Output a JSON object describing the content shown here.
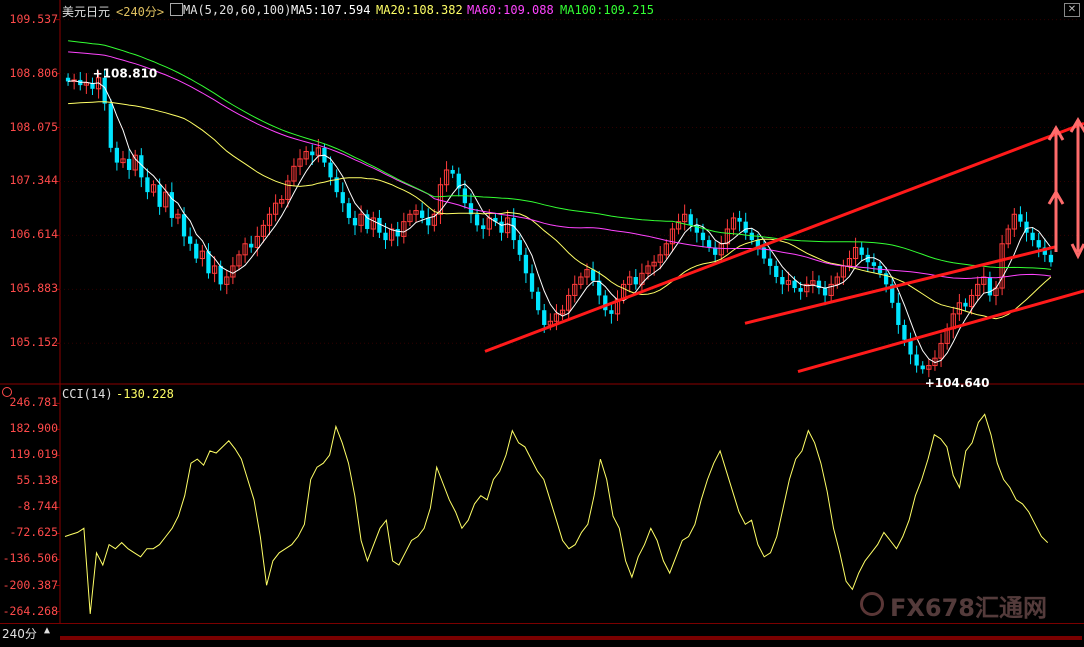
{
  "header": {
    "symbol": "美元日元",
    "period_label": "<240分>",
    "ma_icon": "chart-indicator-icon",
    "ma_params": "MA(5,20,60,100)",
    "ma5": "MA5:107.594",
    "ma20": "MA20:108.382",
    "ma60": "MA60:109.088",
    "ma100": "MA100:109.215"
  },
  "cci_header": {
    "label": "CCI(14)",
    "value": "-130.228"
  },
  "footer": {
    "period_tab": "240分",
    "period_arrow": "▲"
  },
  "watermark": {
    "text": "FX678汇通网"
  },
  "colors": {
    "background": "#000000",
    "axis_label": "#ff4a4a",
    "candle_up": "#ff3b3b",
    "candle_down": "#00e5ff",
    "ma5": "#ffffff",
    "ma20": "#ffff66",
    "ma60": "#ff44ff",
    "ma100": "#33ff33",
    "cci": "#ffff66",
    "annotation": "#ff1a1a",
    "arrow": "#ff6b6b",
    "grid": "#8b0000"
  },
  "chart_data": [
    {
      "type": "candlestick",
      "title": "美元日元 240分",
      "ylim": [
        104.6,
        109.6
      ],
      "yticks": [
        109.537,
        108.806,
        108.075,
        107.344,
        106.614,
        105.883,
        105.152
      ],
      "annotations": [
        {
          "text": "108.810",
          "value": 108.81
        },
        {
          "text": "104.640",
          "value": 104.64
        }
      ],
      "series": [
        {
          "name": "Close",
          "values": [
            108.7,
            108.72,
            108.65,
            108.68,
            108.6,
            108.75,
            108.4,
            107.8,
            107.6,
            107.65,
            107.5,
            107.7,
            107.4,
            107.2,
            107.3,
            107.0,
            107.2,
            106.85,
            106.9,
            106.6,
            106.5,
            106.3,
            106.4,
            106.1,
            106.2,
            105.95,
            106.05,
            106.2,
            106.35,
            106.5,
            106.45,
            106.6,
            106.75,
            106.9,
            107.05,
            107.1,
            107.35,
            107.55,
            107.65,
            107.75,
            107.7,
            107.8,
            107.6,
            107.4,
            107.2,
            107.05,
            106.85,
            106.75,
            106.9,
            106.7,
            106.85,
            106.65,
            106.55,
            106.7,
            106.6,
            106.8,
            106.9,
            106.95,
            106.85,
            106.75,
            106.9,
            107.3,
            107.5,
            107.45,
            107.25,
            107.05,
            106.9,
            106.75,
            106.7,
            106.85,
            106.8,
            106.65,
            106.85,
            106.55,
            106.35,
            106.1,
            105.85,
            105.6,
            105.4,
            105.45,
            105.55,
            105.6,
            105.8,
            105.95,
            106.05,
            106.15,
            106.0,
            105.8,
            105.6,
            105.55,
            105.75,
            105.95,
            106.05,
            105.95,
            106.1,
            106.2,
            106.25,
            106.35,
            106.5,
            106.7,
            106.8,
            106.9,
            106.75,
            106.65,
            106.55,
            106.45,
            106.35,
            106.5,
            106.7,
            106.85,
            106.8,
            106.65,
            106.55,
            106.45,
            106.3,
            106.2,
            106.05,
            105.95,
            106.0,
            105.9,
            105.85,
            105.95,
            106.0,
            105.9,
            105.8,
            105.95,
            106.05,
            106.2,
            106.3,
            106.45,
            106.35,
            106.25,
            106.2,
            106.1,
            105.95,
            105.7,
            105.4,
            105.2,
            105.0,
            104.85,
            104.8,
            104.85,
            104.95,
            105.15,
            105.35,
            105.55,
            105.7,
            105.65,
            105.8,
            105.95,
            106.05,
            105.8,
            105.9,
            106.5,
            106.7,
            106.9,
            106.8,
            106.65,
            106.55,
            106.45,
            106.35,
            106.25
          ],
          "ma": {
            "MA5": 107.594,
            "MA20": 108.382,
            "MA60": 109.088,
            "MA100": 109.215
          }
        }
      ]
    },
    {
      "type": "line",
      "title": "CCI(14)",
      "ylim": [
        -290,
        260
      ],
      "yticks": [
        246.781,
        182.9,
        119.019,
        55.138,
        -8.744,
        -72.625,
        -136.506,
        -200.387,
        -264.268
      ],
      "series": [
        {
          "name": "CCI(14)",
          "values": [
            -80,
            -75,
            -70,
            -60,
            -270,
            -120,
            -150,
            -100,
            -110,
            -95,
            -110,
            -120,
            -130,
            -110,
            -110,
            -100,
            -80,
            -60,
            -30,
            20,
            100,
            110,
            95,
            130,
            125,
            140,
            155,
            135,
            110,
            60,
            10,
            -80,
            -200,
            -140,
            -120,
            -110,
            -100,
            -80,
            -50,
            60,
            90,
            100,
            120,
            190,
            150,
            100,
            20,
            -90,
            -140,
            -100,
            -60,
            -40,
            -140,
            -150,
            -120,
            -90,
            -80,
            -60,
            -10,
            90,
            50,
            10,
            -20,
            -60,
            -40,
            0,
            20,
            10,
            60,
            80,
            120,
            180,
            150,
            140,
            110,
            80,
            60,
            10,
            -40,
            -90,
            -110,
            -100,
            -70,
            -50,
            20,
            110,
            60,
            -30,
            -60,
            -140,
            -180,
            -130,
            -100,
            -60,
            -90,
            -140,
            -170,
            -130,
            -90,
            -80,
            -50,
            10,
            60,
            100,
            130,
            80,
            30,
            -20,
            -50,
            -40,
            -100,
            -130,
            -120,
            -80,
            -10,
            60,
            110,
            130,
            180,
            150,
            100,
            30,
            -60,
            -120,
            -190,
            -210,
            -170,
            -140,
            -120,
            -100,
            -70,
            -90,
            -110,
            -80,
            -40,
            20,
            60,
            110,
            170,
            160,
            140,
            70,
            40,
            130,
            150,
            200,
            220,
            170,
            100,
            60,
            40,
            10,
            0,
            -20,
            -50,
            -80,
            -95
          ]
        }
      ]
    }
  ]
}
